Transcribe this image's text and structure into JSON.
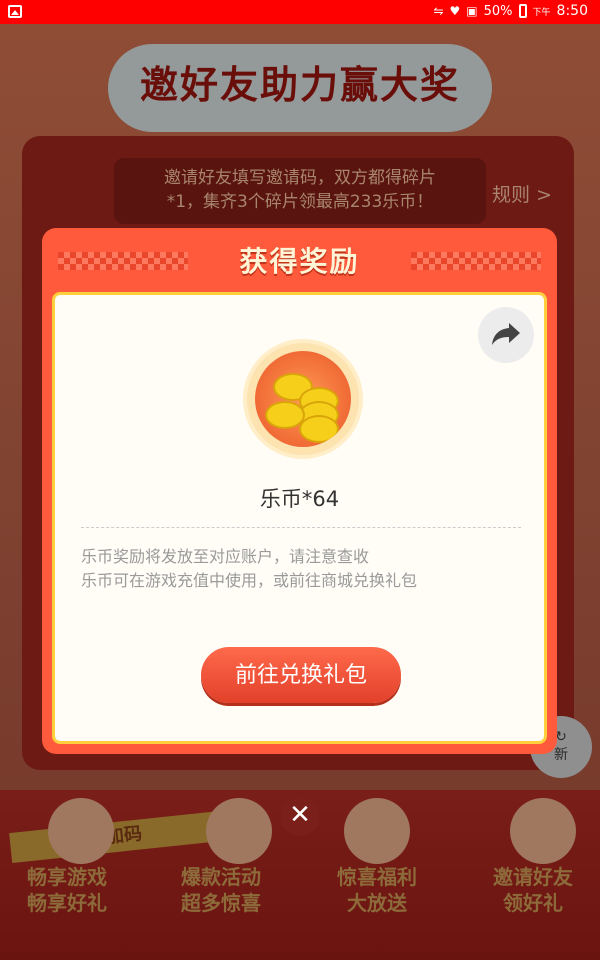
{
  "status_bar": {
    "battery_percent": "50%",
    "ampm": "下午",
    "time": "8:50"
  },
  "background": {
    "title": "邀好友助力赢大奖",
    "invite_text_line1": "邀请好友填写邀请码，双方都得碎片",
    "invite_text_line2": "*1，集齐3个碎片领最高233乐币！",
    "rules_link": "规则 >",
    "refresh_label": "新",
    "banner_text": "礼包加码",
    "features": [
      {
        "line1": "畅享游戏",
        "line2": "畅享好礼"
      },
      {
        "line1": "爆款活动",
        "line2": "超多惊喜"
      },
      {
        "line1": "惊喜福利",
        "line2": "大放送"
      },
      {
        "line1": "邀请好友",
        "line2": "领好礼"
      }
    ]
  },
  "modal": {
    "title": "获得奖励",
    "reward_label": "乐币*64",
    "note_line1": "乐币奖励将发放至对应账户，请注意查收",
    "note_line2": "乐币可在游戏充值中使用，或前往商城兑换礼包",
    "exchange_button": "前往兑换礼包",
    "close_symbol": "✕"
  },
  "colors": {
    "status_bar": "#ff0000",
    "modal_red": "#ff5a3c",
    "modal_border": "#ffcf3d",
    "coin_gold": "#f6cf1a"
  }
}
